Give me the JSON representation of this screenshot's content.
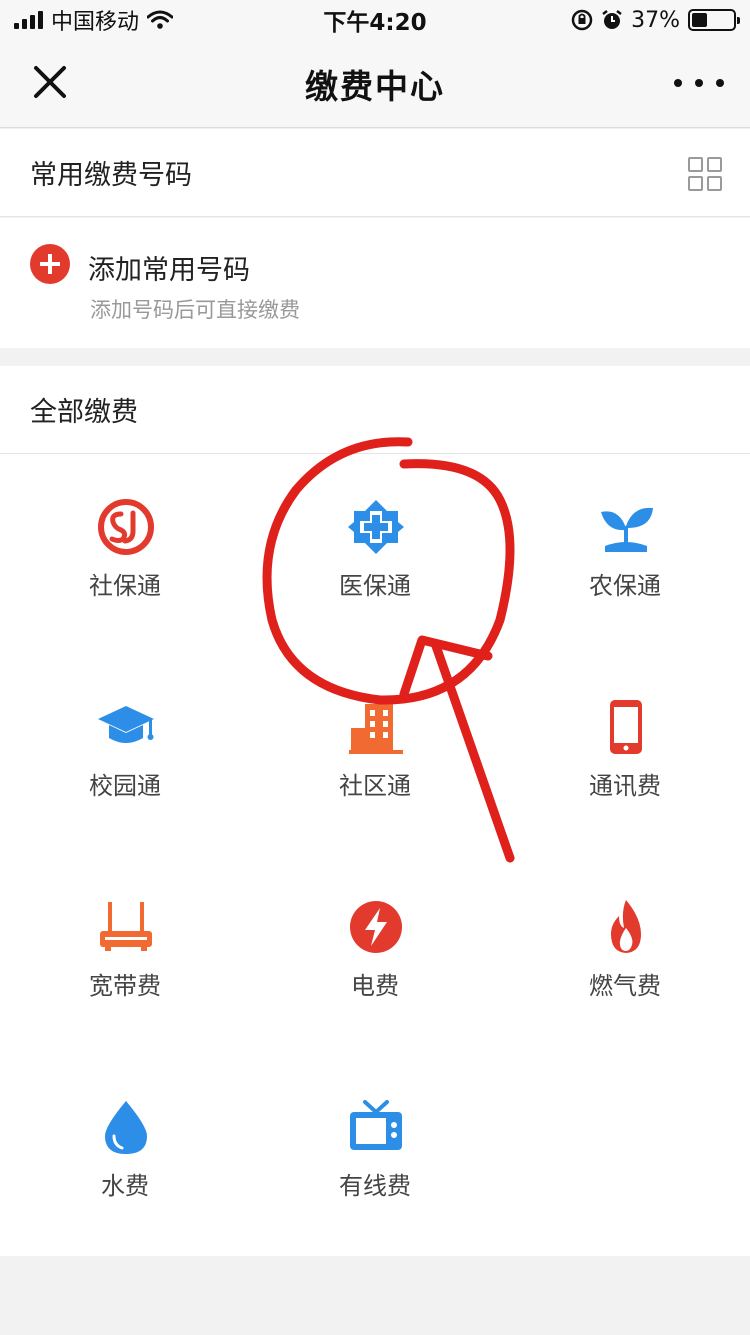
{
  "status_bar": {
    "carrier": "中国移动",
    "time": "下午4:20",
    "battery": "37%",
    "battery_level": 0.37
  },
  "nav": {
    "title": "缴费中心"
  },
  "frequent": {
    "title": "常用缴费号码",
    "add_title": "添加常用号码",
    "add_subtitle": "添加号码后可直接缴费"
  },
  "all": {
    "title": "全部缴费"
  },
  "services": [
    {
      "label": "社保通",
      "icon": "social-security-icon"
    },
    {
      "label": "医保通",
      "icon": "medical-insurance-icon"
    },
    {
      "label": "农保通",
      "icon": "agriculture-insurance-icon"
    },
    {
      "label": "校园通",
      "icon": "graduation-cap-icon"
    },
    {
      "label": "社区通",
      "icon": "building-icon"
    },
    {
      "label": "通讯费",
      "icon": "phone-icon"
    },
    {
      "label": "宽带费",
      "icon": "router-icon"
    },
    {
      "label": "电费",
      "icon": "lightning-icon"
    },
    {
      "label": "燃气费",
      "icon": "flame-icon"
    },
    {
      "label": "水费",
      "icon": "water-drop-icon"
    },
    {
      "label": "有线费",
      "icon": "tv-icon"
    }
  ],
  "colors": {
    "red": "#e23b2e",
    "blue": "#2c8ee6",
    "orange": "#f06a32",
    "annotation_red": "#e0201a"
  }
}
